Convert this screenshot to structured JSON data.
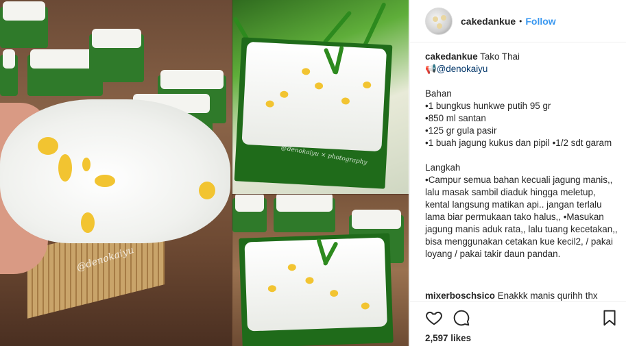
{
  "post": {
    "username": "cakedankue",
    "dot": "•",
    "follow_label": "Follow"
  },
  "caption": {
    "username": "cakedankue",
    "title": "Tako Thai",
    "mention_prefix": "📢",
    "mention": "@denokaiyu",
    "bahan_heading": "Bahan",
    "bahan": [
      "•1 bungkus hunkwe putih 95 gr",
      "•850 ml santan",
      "•125 gr gula pasir",
      "•1 buah jagung kukus dan pipil •1/2 sdt garam"
    ],
    "langkah_heading": "Langkah",
    "langkah": "•Campur semua bahan kecuali jagung manis,, lalu masak sambil diaduk hingga meletup, kental langsung matikan api.. jangan terlalu lama biar permukaan tako halus,, •Masukan jagung manis aduk rata,, lalu tuang kecetakan,, bisa menggunakan cetakan kue kecil2, / pakai loyang / pakai takir daun pandan."
  },
  "comment": {
    "username": "mixerboschsico",
    "text": "Enakkk manis qurihh thx"
  },
  "actions": {
    "like_icon": "heart-icon",
    "comment_icon": "comment-bubble-icon",
    "save_icon": "bookmark-icon",
    "likes_text": "2,597 likes"
  },
  "media": {
    "watermark_1": "@denokaiyu",
    "watermark_2": "@denokaiyu × photography"
  }
}
